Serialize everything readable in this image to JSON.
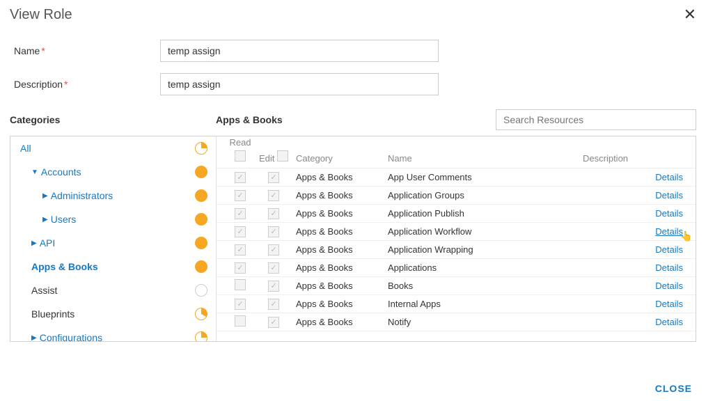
{
  "header": {
    "title": "View Role"
  },
  "form": {
    "name_label": "Name",
    "name_value": "temp assign",
    "description_label": "Description",
    "description_value": "temp assign"
  },
  "sections": {
    "categories_label": "Categories",
    "apps_label": "Apps & Books"
  },
  "search": {
    "placeholder": "Search Resources"
  },
  "sidebar": {
    "items": [
      {
        "label": "All",
        "indent": 0,
        "chev": "",
        "style": "link",
        "fill": 90
      },
      {
        "label": "Accounts",
        "indent": 1,
        "chev": "down",
        "style": "link",
        "fill": 360
      },
      {
        "label": "Administrators",
        "indent": 2,
        "chev": "right",
        "style": "link",
        "fill": 360
      },
      {
        "label": "Users",
        "indent": 2,
        "chev": "right",
        "style": "link",
        "fill": 360
      },
      {
        "label": "API",
        "indent": 1,
        "chev": "right",
        "style": "link",
        "fill": 360
      },
      {
        "label": "Apps & Books",
        "indent": 1,
        "chev": "",
        "style": "selected",
        "fill": 360
      },
      {
        "label": "Assist",
        "indent": 1,
        "chev": "",
        "style": "plain",
        "fill": 0
      },
      {
        "label": "Blueprints",
        "indent": 1,
        "chev": "",
        "style": "plain",
        "fill": 120
      },
      {
        "label": "Configurations",
        "indent": 1,
        "chev": "right",
        "style": "link",
        "fill": 90
      }
    ]
  },
  "table": {
    "headers": {
      "read": "Read",
      "edit": "Edit",
      "category": "Category",
      "name": "Name",
      "description": "Description",
      "details": "Details"
    },
    "rows": [
      {
        "read": true,
        "edit": true,
        "category": "Apps & Books",
        "name": "App User Comments"
      },
      {
        "read": true,
        "edit": true,
        "category": "Apps & Books",
        "name": "Application Groups"
      },
      {
        "read": true,
        "edit": true,
        "category": "Apps & Books",
        "name": "Application Publish"
      },
      {
        "read": true,
        "edit": true,
        "category": "Apps & Books",
        "name": "Application Workflow",
        "hover": true
      },
      {
        "read": true,
        "edit": true,
        "category": "Apps & Books",
        "name": "Application Wrapping"
      },
      {
        "read": true,
        "edit": true,
        "category": "Apps & Books",
        "name": "Applications"
      },
      {
        "read": false,
        "edit": true,
        "category": "Apps & Books",
        "name": "Books"
      },
      {
        "read": true,
        "edit": true,
        "category": "Apps & Books",
        "name": "Internal Apps"
      },
      {
        "read": false,
        "edit": true,
        "category": "Apps & Books",
        "name": "Notify"
      }
    ]
  },
  "footer": {
    "close": "CLOSE"
  }
}
